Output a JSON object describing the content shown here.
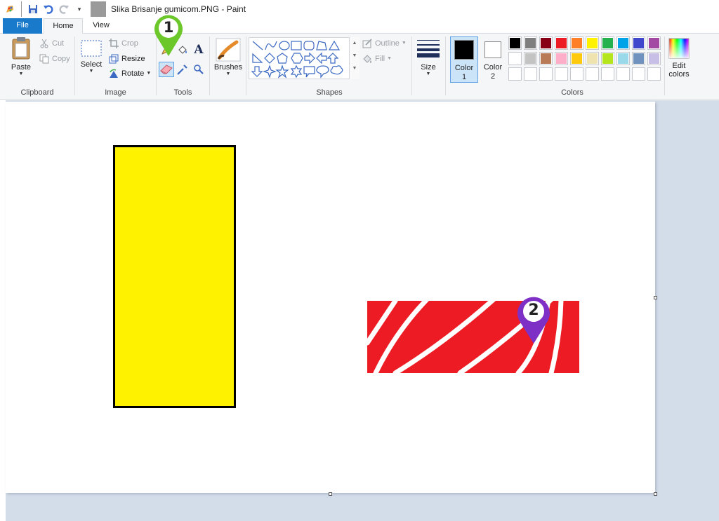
{
  "window": {
    "title": "Slika Brisanje gumicom.PNG - Paint"
  },
  "quick_access": {
    "icons": [
      "paint-app-icon",
      "save-icon",
      "undo-icon",
      "redo-icon",
      "customize-icon"
    ]
  },
  "tabs": [
    {
      "label": "File"
    },
    {
      "label": "Home"
    },
    {
      "label": "View"
    }
  ],
  "ribbon": {
    "clipboard": {
      "paste_label": "Paste",
      "cut_label": "Cut",
      "copy_label": "Copy",
      "group_label": "Clipboard"
    },
    "image": {
      "select_label": "Select",
      "crop_label": "Crop",
      "resize_label": "Resize",
      "rotate_label": "Rotate",
      "group_label": "Image"
    },
    "tools": {
      "group_label": "Tools",
      "active_tool": "eraser-icon"
    },
    "brushes": {
      "label": "Brushes"
    },
    "shapes": {
      "outline_label": "Outline",
      "fill_label": "Fill",
      "group_label": "Shapes"
    },
    "size": {
      "label": "Size"
    },
    "color1": {
      "label_line1": "Color",
      "label_line2": "1",
      "value": "#000000"
    },
    "color2": {
      "label_line1": "Color",
      "label_line2": "2",
      "value": "#ffffff"
    },
    "colors": {
      "group_label": "Colors",
      "palette_row1": [
        "#000000",
        "#7f7f7f",
        "#880015",
        "#ed1c24",
        "#ff7f27",
        "#fff200",
        "#22b14c",
        "#00a2e8",
        "#3f48cc",
        "#a349a4"
      ],
      "palette_row2": [
        "#ffffff",
        "#c3c3c3",
        "#b97a57",
        "#ffaec9",
        "#ffc90e",
        "#efe4b0",
        "#b5e61d",
        "#99d9ea",
        "#7092be",
        "#c8bfe7"
      ],
      "palette_row3": [
        "#ffffff",
        "#ffffff",
        "#ffffff",
        "#ffffff",
        "#ffffff",
        "#ffffff",
        "#ffffff",
        "#ffffff",
        "#ffffff",
        "#ffffff"
      ]
    },
    "edit_colors": {
      "label_line1": "Edit",
      "label_line2": "colors"
    }
  },
  "canvas": {
    "shapes": [
      {
        "name": "yellow-rectangle",
        "fill": "#fff200",
        "outline": "#000000"
      },
      {
        "name": "red-rectangle-erased",
        "fill": "#ed1c24",
        "erased_strokes": "#ffffff"
      }
    ]
  },
  "markers": [
    {
      "label": "1",
      "color": "#6cc72b",
      "target": "eraser-tool"
    },
    {
      "label": "2",
      "color": "#7e2fc5",
      "target": "red-rectangle"
    }
  ]
}
